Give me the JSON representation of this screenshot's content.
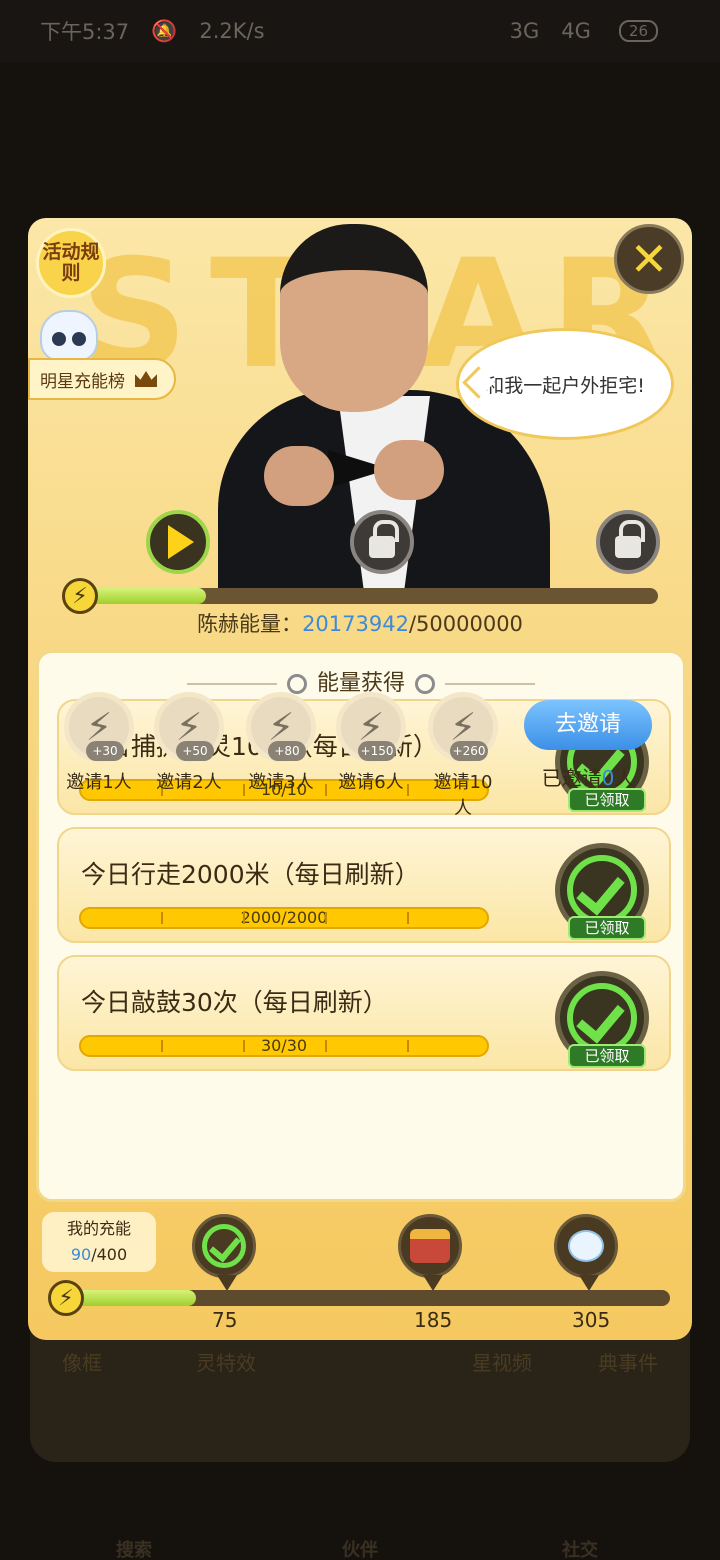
{
  "status_bar": {
    "time": "下午5:37",
    "net_speed": "2.2K/s",
    "signal_3g": "3G",
    "signal_4g": "4G",
    "battery": "26"
  },
  "background": {
    "labels": [
      "像框",
      "灵特效",
      "星视频",
      "典事件"
    ],
    "nav": [
      "搜索",
      "伙伴",
      "社交"
    ]
  },
  "header": {
    "rules_label": "活动规则",
    "rank_label": "明星充能榜",
    "close_icon": "close-icon"
  },
  "banner": {
    "watermark": "STAR",
    "speech": "和我一起户外拒宅!"
  },
  "celebrity_energy": {
    "label": "陈赫能量：",
    "current": "20173942",
    "separator": "/",
    "target": "50000000",
    "progress": 0.22
  },
  "tasks_panel": {
    "title": "能量获得",
    "tasks": [
      {
        "name": "今日捕捉妖灵10只（每日刷新）",
        "progress_text": "10/10",
        "status": "已领取"
      },
      {
        "name": "今日行走2000米（每日刷新）",
        "progress_text": "2000/2000",
        "status": "已领取"
      },
      {
        "name": "今日敲鼓30次（每日刷新）",
        "progress_text": "30/30",
        "status": "已领取"
      }
    ],
    "invites": [
      {
        "bonus": "+30",
        "label": "邀请1人"
      },
      {
        "bonus": "+50",
        "label": "邀请2人"
      },
      {
        "bonus": "+80",
        "label": "邀请3人"
      },
      {
        "bonus": "+150",
        "label": "邀请6人"
      },
      {
        "bonus": "+260",
        "label": "邀请10人"
      }
    ],
    "invite_button": "去邀请",
    "invited_prefix": "已邀请",
    "invited_count": "0",
    "invited_suffix": "人"
  },
  "my_charge": {
    "label": "我的充能",
    "current": "90",
    "separator": "/",
    "max": "400",
    "progress": 0.225
  },
  "milestones": [
    {
      "value": "75",
      "reward": "claimed-check"
    },
    {
      "value": "185",
      "reward": "gift-icon"
    },
    {
      "value": "305",
      "reward": "pet-icon"
    }
  ],
  "colors": {
    "accent_blue": "#3c8ad8",
    "progress_green": "#9ed02c",
    "bar_yellow": "#ffc800",
    "claimed_green": "#6fe24a"
  }
}
